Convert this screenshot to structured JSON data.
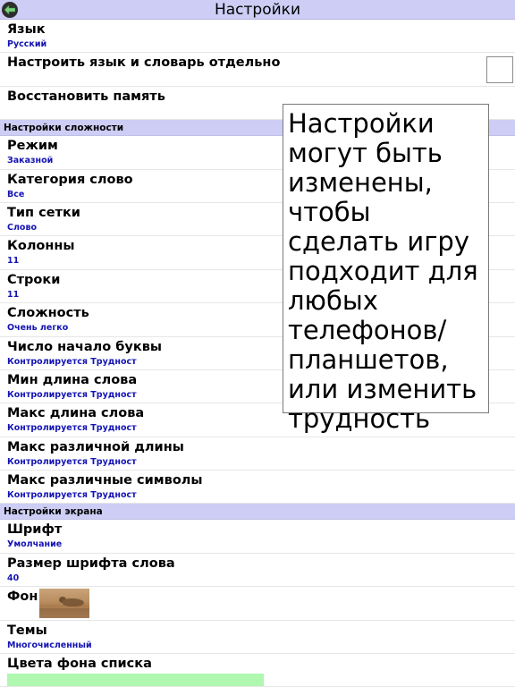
{
  "header": {
    "title": "Настройки"
  },
  "rows_top": [
    {
      "label": "Язык",
      "value": "Русский"
    },
    {
      "label": "Настроить язык и словарь отдельно"
    },
    {
      "label": "Восстановить память"
    }
  ],
  "sections": {
    "difficulty": "Настройки сложности",
    "screen": "Настройки экрана"
  },
  "difficulty_rows": [
    {
      "label": "Режим",
      "value": "Заказной"
    },
    {
      "label": "Категория слово",
      "value": "Все"
    },
    {
      "label": "Тип сетки",
      "value": "Слово"
    },
    {
      "label": "Колонны",
      "value": "11"
    },
    {
      "label": "Строки",
      "value": "11"
    },
    {
      "label": "Сложность",
      "value": "Очень легко"
    },
    {
      "label": "Число начало буквы",
      "value": "Контролируется Трудност"
    },
    {
      "label": "Мин длина слова",
      "value": "Контролируется Трудност"
    },
    {
      "label": "Макс длина слова",
      "value": "Контролируется Трудност"
    },
    {
      "label": "Макс различной длины",
      "value": "Контролируется Трудност"
    },
    {
      "label": "Макс различные символы",
      "value": "Контролируется Трудност"
    }
  ],
  "screen_rows": [
    {
      "label": "Шрифт",
      "value": "Умолчание"
    },
    {
      "label": "Размер шрифта слова",
      "value": "40"
    },
    {
      "label": "Фон"
    },
    {
      "label": "Темы",
      "value": "Многочисленный"
    },
    {
      "label": "Цвета фона списка"
    }
  ],
  "tooltip": "Настройки могут быть изменены, чтобы сделать игру подходит для любых телефонов/планшетов, или изменить трудность",
  "colors": {
    "header_bg": "#cdcdf5",
    "value_text": "#1414b4",
    "list_bg_swatch": "#b0f7b0"
  },
  "icons": {
    "back": "back-arrow-icon"
  }
}
